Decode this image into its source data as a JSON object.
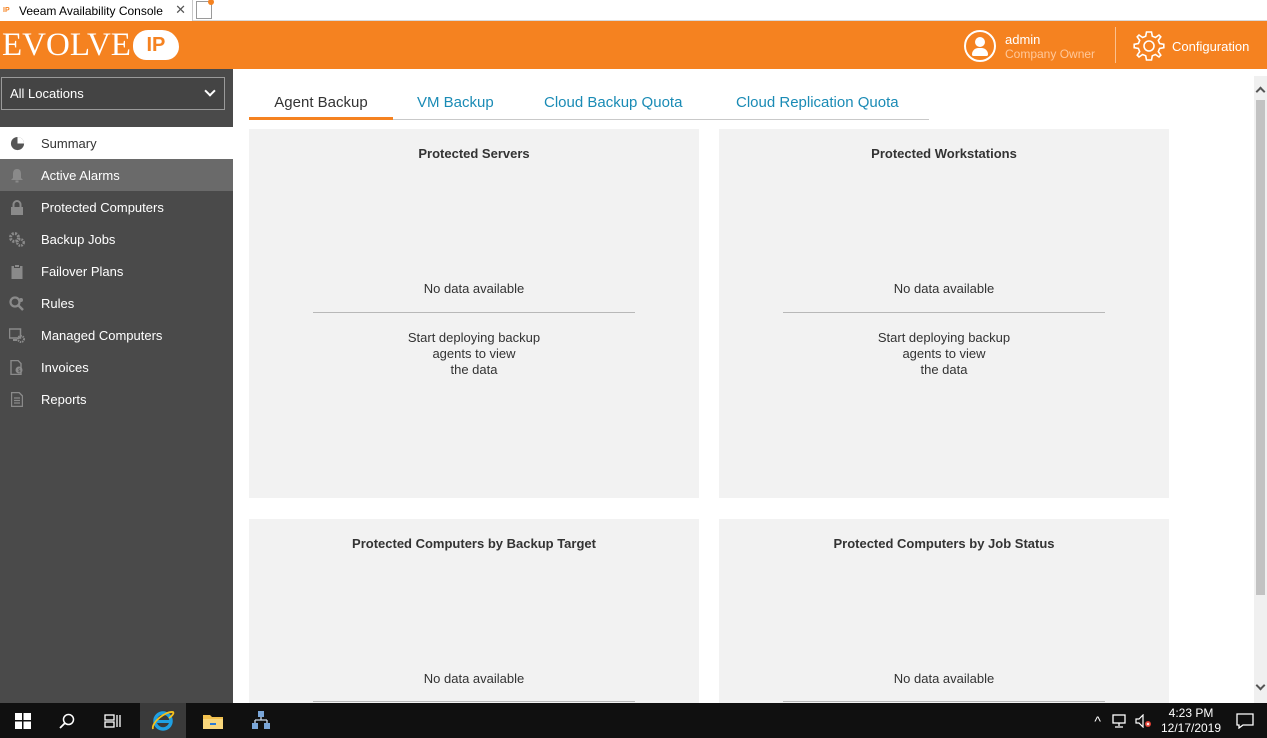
{
  "browser": {
    "tab_title": "Veeam Availability Console",
    "favicon_text": "IP"
  },
  "header": {
    "logo_text": "EVOLVE",
    "logo_badge": "IP",
    "user_name": "admin",
    "user_role": "Company Owner",
    "config_label": "Configuration",
    "accent_color": "#f58220"
  },
  "sidebar": {
    "location_select": "All Locations",
    "items": [
      {
        "label": "Summary",
        "icon": "pie-chart-icon",
        "state": "active"
      },
      {
        "label": "Active Alarms",
        "icon": "bell-icon",
        "state": "hover"
      },
      {
        "label": "Protected Computers",
        "icon": "lock-icon",
        "state": ""
      },
      {
        "label": "Backup Jobs",
        "icon": "gears-icon",
        "state": ""
      },
      {
        "label": "Failover Plans",
        "icon": "clipboard-icon",
        "state": ""
      },
      {
        "label": "Rules",
        "icon": "rules-icon",
        "state": ""
      },
      {
        "label": "Managed Computers",
        "icon": "computer-gear-icon",
        "state": ""
      },
      {
        "label": "Invoices",
        "icon": "invoice-icon",
        "state": ""
      },
      {
        "label": "Reports",
        "icon": "report-icon",
        "state": ""
      }
    ]
  },
  "tabs": [
    {
      "label": "Agent Backup",
      "active": true
    },
    {
      "label": "VM Backup",
      "active": false
    },
    {
      "label": "Cloud Backup Quota",
      "active": false
    },
    {
      "label": "Cloud Replication Quota",
      "active": false
    }
  ],
  "panels": [
    {
      "title": "Protected Servers",
      "empty_text": "No data available",
      "hint": [
        "Start deploying backup",
        "agents to view",
        "the data"
      ]
    },
    {
      "title": "Protected Workstations",
      "empty_text": "No data available",
      "hint": [
        "Start deploying backup",
        "agents to view",
        "the data"
      ]
    },
    {
      "title": "Protected Computers by Backup Target",
      "empty_text": "No data available"
    },
    {
      "title": "Protected Computers by Job Status",
      "empty_text": "No data available"
    }
  ],
  "taskbar": {
    "time": "4:23 PM",
    "date": "12/17/2019"
  }
}
